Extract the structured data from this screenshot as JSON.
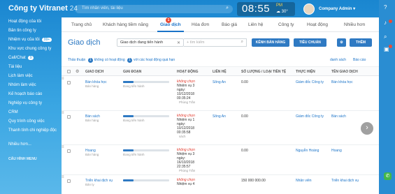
{
  "app": {
    "brand": "Công ty Vitranet",
    "brand_num": "24"
  },
  "topbar": {
    "search_placeholder": "Tìm nhân viên, tài liệu",
    "clock": "08:55",
    "clock_period": "PM",
    "weather": "☁ 30°",
    "user_name": "Company Admin",
    "user_caret": "▾"
  },
  "sidebar": {
    "items": [
      {
        "label": "Hoạt động của tôi"
      },
      {
        "label": "Bản tin công ty"
      },
      {
        "label": "Nhiệm vụ của tôi",
        "badge": "99+"
      },
      {
        "label": "Khu vực chung công ty"
      },
      {
        "label": "Call/Chat",
        "badge": "9"
      },
      {
        "label": "Tài liệu"
      },
      {
        "label": "Lịch làm việc"
      },
      {
        "label": "Nhóm làm việc"
      },
      {
        "label": "Kế hoạch báo cáo"
      },
      {
        "label": "Nghiệp vụ công ty"
      },
      {
        "label": "CRM"
      },
      {
        "label": "Quy trình công việc"
      },
      {
        "label": "Thanh tính chi nghiệp độc"
      },
      {
        "label": "Nhiều hơn..."
      }
    ],
    "section": "CẤU HÌNH MENU"
  },
  "tabs": [
    {
      "label": "Trang chủ"
    },
    {
      "label": "Khách hàng tiềm năng"
    },
    {
      "label": "Giao dịch",
      "badge": "1",
      "active": true
    },
    {
      "label": "Hóa đơn"
    },
    {
      "label": "Báo giá"
    },
    {
      "label": "Liên hệ"
    },
    {
      "label": "Công ty"
    },
    {
      "label": "Hoạt động"
    },
    {
      "label": "Nhiều hơn"
    }
  ],
  "page": {
    "title": "Giao dịch",
    "filter": "Giao dịch đang tiến hành",
    "filter_clear": "✕",
    "search_placeholder": "+ tìm kiếm",
    "btn_new": "KÊNH BÁN HÀNG",
    "btn_criteria": "TIÊU CHUẨN",
    "btn_add": "THÊM"
  },
  "subfilters": {
    "pre": "Thảo thuận",
    "count1": "1",
    "label1": "không có hoạt động",
    "count2": "1",
    "label2": "với các hoạt động quá hạn",
    "link1": "danh sách",
    "link2": "Báo cáo"
  },
  "table": {
    "headers": [
      "GIAO DỊCH",
      "GIAI ĐOẠN",
      "HOẠT ĐỘNG",
      "LIÊN HỆ",
      "SỐ LƯỢNG / LOẠI TIỀN TỆ",
      "THỰC HIỆN",
      "TÊN GIAO DỊCH"
    ],
    "rows": [
      {
        "name": "Bán khóa học",
        "sub": "Bán hàng",
        "stage_label": "Đang tiến hành",
        "stage_pct": 22,
        "activity": "không chọn",
        "act_lines": [
          "Nhiệm vụ 3",
          "ngày:",
          "10/12/2018",
          "00:35:24"
        ],
        "act_by": "Phùng Trần",
        "contact": "Sông An",
        "amount": "0.00",
        "owner": "Giám đốc Công ty",
        "deal": "Bán khóa học"
      },
      {
        "name": "Bán sách",
        "sub": "Bán hàng",
        "stage_label": "Đang tiến hành",
        "stage_pct": 22,
        "activity": "không chọn",
        "act_lines": [
          "Nhiệm vụ 1",
          "ngày:",
          "10/12/2018",
          "00:35:58"
        ],
        "act_by": "sách",
        "contact": "Sông An",
        "amount": "0.00",
        "owner": "Giám đốc Công ty",
        "deal": "Bán sách"
      },
      {
        "name": "Hoang",
        "sub": "Bán hàng",
        "stage_label": "Đang tiến hành",
        "stage_pct": 22,
        "activity": "không chọn",
        "act_lines": [
          "Nhiệm vụ 3",
          "ngày:",
          "16/10/2018",
          "22:35:57"
        ],
        "act_by": "Phùng Trần",
        "contact": "",
        "amount": "0.00",
        "owner": "Nguyễn Hoàng",
        "deal": "Hoang"
      },
      {
        "name": "Triển khai dịch vụ",
        "sub": "Bản ty",
        "stage_label": "",
        "stage_pct": 22,
        "activity": "không chọn",
        "act_lines": [
          "Nhiệm vụ 4"
        ],
        "act_by": "",
        "contact": "",
        "amount": "150 000 000.00",
        "owner": "Nhân viên",
        "deal": "Triển khai dịch vụ"
      }
    ]
  },
  "colors": {
    "accent": "#1a73c8",
    "sky": "#2d9bdc",
    "danger": "#e23b2e",
    "badge": "#e94b35"
  },
  "icons": [
    "help-icon",
    "bell-icon",
    "search-icon",
    "gift-icon",
    "phone-icon",
    "chevron-right-icon",
    "settings-icon"
  ]
}
